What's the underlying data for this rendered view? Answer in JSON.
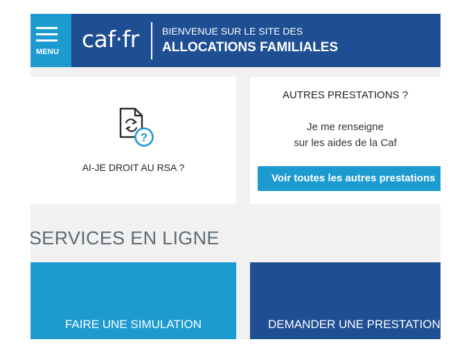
{
  "header": {
    "menu_label": "MENU",
    "logo": "caf·fr",
    "welcome_line1": "BIENVENUE SUR LE SITE DES",
    "welcome_line2": "ALLOCATIONS FAMILIALES",
    "background": "#1f4f93",
    "menu_background": "#1d9bd1"
  },
  "rsa_card": {
    "icon": "document-question-icon",
    "title": "AI-JE DROIT AU RSA ?"
  },
  "other_card": {
    "title": "AUTRES PRESTATIONS ?",
    "text_line1": "Je me renseigne",
    "text_line2": "sur les aides de la Caf",
    "button_label": "Voir toutes les autres prestations"
  },
  "services": {
    "title": "SERVICES EN LIGNE",
    "tiles": [
      {
        "label": "FAIRE UNE SIMULATION",
        "color": "#1d9bd1"
      },
      {
        "label": "DEMANDER UNE PRESTATION",
        "color": "#1f4f93"
      }
    ]
  }
}
